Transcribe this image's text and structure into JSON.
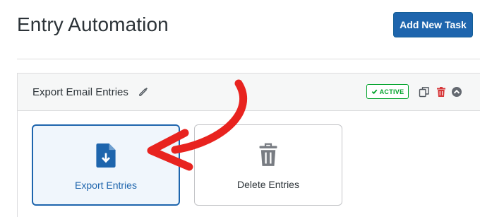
{
  "page": {
    "title": "Entry Automation",
    "add_button_label": "Add New Task"
  },
  "task": {
    "name": "Export Email Entries",
    "status": "ACTIVE",
    "actions": [
      {
        "name": "duplicate-icon"
      },
      {
        "name": "trash-icon"
      },
      {
        "name": "collapse-icon"
      }
    ]
  },
  "cards": [
    {
      "label": "Export Entries",
      "icon": "file-download-icon",
      "selected": true
    },
    {
      "label": "Delete Entries",
      "icon": "trash-icon",
      "selected": false
    }
  ],
  "colors": {
    "primary": "#1e65ad",
    "active": "#00a32a",
    "danger": "#d63638",
    "arrow": "#e8231f",
    "selected_bg": "#f0f6fc"
  }
}
